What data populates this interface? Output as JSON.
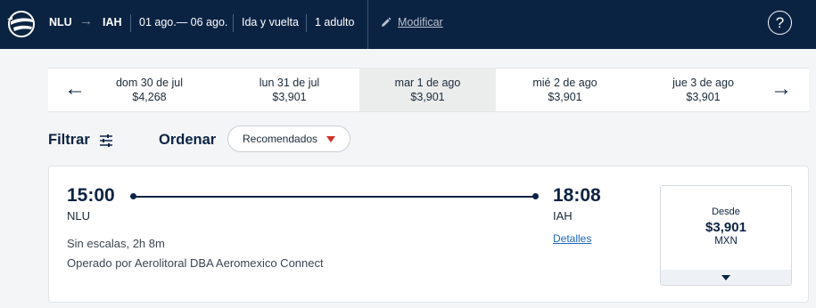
{
  "header": {
    "origin": "NLU",
    "destination": "IAH",
    "dates": "01 ago.— 06 ago.",
    "trip_type": "Ida y vuelta",
    "passengers": "1 adulto",
    "modify_label": "Modificar",
    "help_label": "?"
  },
  "date_strip": {
    "prev_label": "←",
    "next_label": "→",
    "days": [
      {
        "date": "dom 30 de jul",
        "price": "$4,268"
      },
      {
        "date": "lun 31 de jul",
        "price": "$3,901"
      },
      {
        "date": "mar 1 de ago",
        "price": "$3,901"
      },
      {
        "date": "mié 2 de ago",
        "price": "$3,901"
      },
      {
        "date": "jue 3 de ago",
        "price": "$3,901"
      }
    ]
  },
  "toolbar": {
    "filter_label": "Filtrar",
    "sort_label": "Ordenar",
    "sort_value": "Recomendados"
  },
  "flight": {
    "depart_time": "15:00",
    "depart_code": "NLU",
    "arrive_time": "18:08",
    "arrive_code": "IAH",
    "duration": "Sin escalas, 2h 8m",
    "operator": "Operado por Aerolitoral DBA Aeromexico Connect",
    "details_label": "Detalles",
    "price_prefix": "Desde",
    "price": "$3,901",
    "currency": "MXN"
  },
  "colors": {
    "header_bg": "#0b2343",
    "accent_red": "#d0302a",
    "link_blue": "#1f66b8"
  }
}
